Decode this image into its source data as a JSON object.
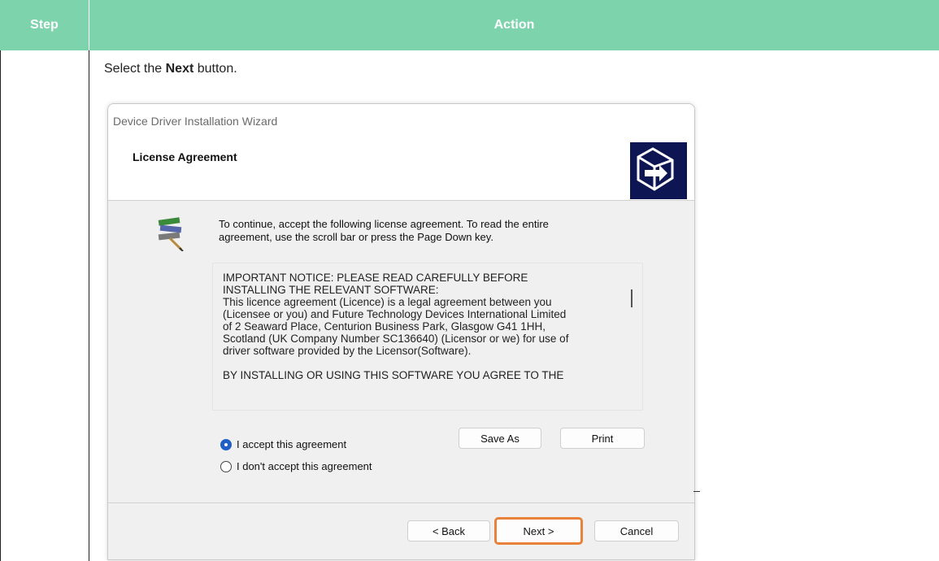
{
  "table": {
    "header_step": "Step",
    "header_action": "Action",
    "instruction_prefix": "Select the ",
    "instruction_bold": "Next",
    "instruction_suffix": " button."
  },
  "dialog": {
    "title": "Device Driver Installation Wizard",
    "banner_title": "License Agreement",
    "intro_line1": "To continue, accept the following license agreement. To read the entire",
    "intro_line2": "agreement, use the scroll bar or press the Page Down key.",
    "license_text": "IMPORTANT NOTICE: PLEASE READ CAREFULLY BEFORE\nINSTALLING THE RELEVANT SOFTWARE:\nThis licence agreement (Licence) is a legal agreement between you\n(Licensee or you) and Future Technology Devices International Limited\nof 2 Seaward Place, Centurion Business Park, Glasgow G41 1HH,\nScotland (UK Company Number SC136640) (Licensor or we) for use of\ndriver software provided by the Licensor(Software).\n\nBY INSTALLING OR USING THIS SOFTWARE YOU AGREE TO THE",
    "accept_label": "I accept this agreement",
    "decline_label": "I don't accept this agreement",
    "accept_selected": true,
    "save_as_label": "Save As",
    "print_label": "Print",
    "back_label": "< Back",
    "next_label": "Next >",
    "cancel_label": "Cancel"
  },
  "colors": {
    "header_bg": "#7dd3ac",
    "highlight": "#e8823a",
    "radio_selected": "#1f5fc6",
    "logo_bg": "#0d1652"
  }
}
